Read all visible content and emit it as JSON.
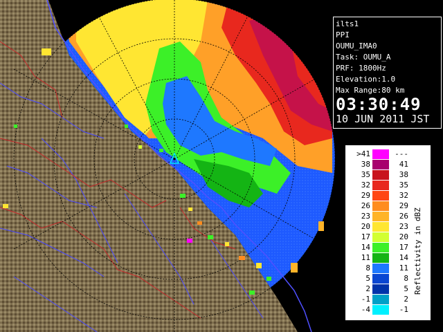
{
  "info": {
    "lines": [
      "ilts1",
      "PPI",
      "OUMU_IMA0",
      "Task: OUMU_A",
      "PRF: 1800Hz",
      "Elevation:1.0",
      "Max Range:80 km"
    ],
    "time": "03:30:49",
    "date": "10 JUN 2011 JST"
  },
  "legend": {
    "title": "Reflectivity in dBZ",
    "rows": [
      {
        "lo": ">41",
        "hi": "---",
        "color": "#ff00ff"
      },
      {
        "lo": "38",
        "hi": "41",
        "color": "#a8006e"
      },
      {
        "lo": "35",
        "hi": "38",
        "color": "#c8141e"
      },
      {
        "lo": "32",
        "hi": "35",
        "color": "#e8281e"
      },
      {
        "lo": "29",
        "hi": "32",
        "color": "#ff4614"
      },
      {
        "lo": "26",
        "hi": "29",
        "color": "#ff8c1e"
      },
      {
        "lo": "23",
        "hi": "26",
        "color": "#ffb428"
      },
      {
        "lo": "20",
        "hi": "23",
        "color": "#ffe632"
      },
      {
        "lo": "17",
        "hi": "20",
        "color": "#d2ff32"
      },
      {
        "lo": "14",
        "hi": "17",
        "color": "#3cf028"
      },
      {
        "lo": "11",
        "hi": "14",
        "color": "#14b414"
      },
      {
        "lo": "8",
        "hi": "11",
        "color": "#1e78ff"
      },
      {
        "lo": "5",
        "hi": "8",
        "color": "#0a46d2"
      },
      {
        "lo": "2",
        "hi": "5",
        "color": "#0032aa"
      },
      {
        "lo": "-1",
        "hi": "2",
        "color": "#00a0c8"
      },
      {
        "lo": "-4",
        "hi": "-1",
        "color": "#00f0ff"
      }
    ]
  },
  "colors": {
    "terrain": "#8a7a5a",
    "sea": "#1e50ff",
    "coast_outline": "#5050ff"
  }
}
